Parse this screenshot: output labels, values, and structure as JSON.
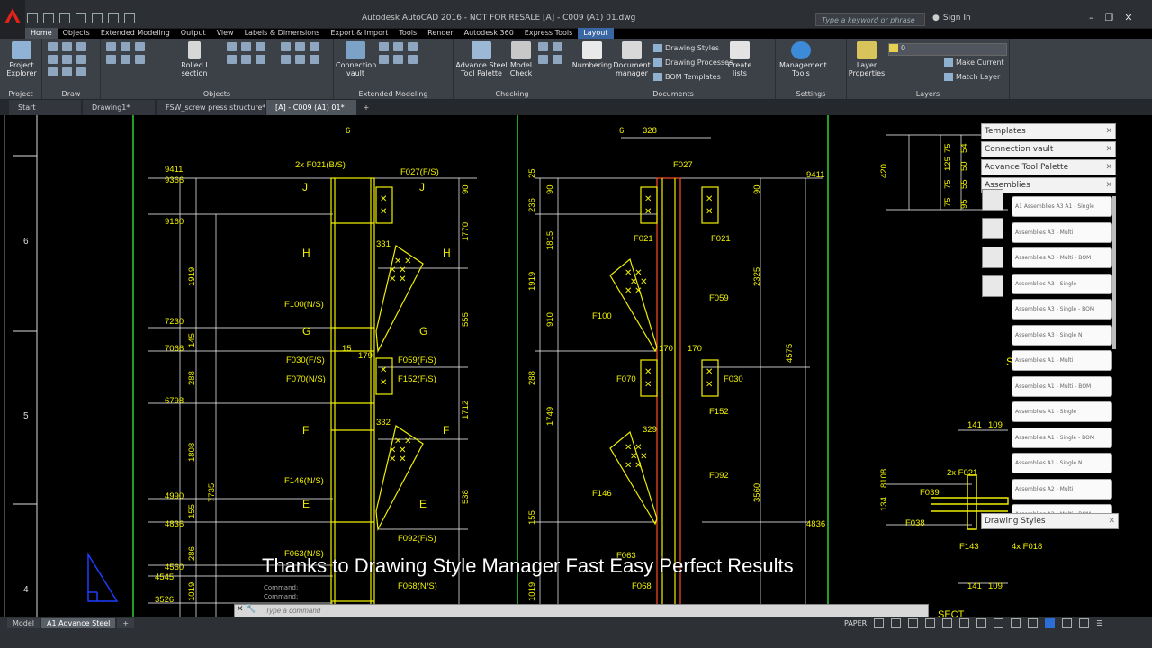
{
  "window": {
    "title": "Autodesk AutoCAD 2016 - NOT FOR RESALE    [A] - C009 (A1) 01.dwg",
    "search_placeholder": "Type a keyword or phrase",
    "signin": "Sign In"
  },
  "ribbon_tabs": [
    "Home",
    "Objects",
    "Extended Modeling",
    "Output",
    "View",
    "Labels & Dimensions",
    "Export & Import",
    "Tools",
    "Render",
    "Autodesk 360",
    "Express Tools",
    "Layout"
  ],
  "ribbon": {
    "project_explorer": "Project Explorer",
    "rolled_section": "Rolled I section",
    "connection_vault": "Connection vault",
    "advance_steel_tool_palette": "Advance Steel Tool Palette",
    "model_check": "Model Check",
    "numbering": "Numbering",
    "document_manager": "Document manager",
    "drawing_styles": "Drawing Styles",
    "drawing_processes": "Drawing Processes",
    "bom_templates": "BOM Templates",
    "create_lists": "Create lists",
    "management_tools": "Management Tools",
    "layer_properties": "Layer Properties",
    "layer_value": "0",
    "make_current": "Make Current",
    "match_layer": "Match Layer",
    "panels": {
      "project": "Project",
      "draw": "Draw",
      "objects": "Objects",
      "extended_modeling": "Extended Modeling",
      "checking": "Checking",
      "documents": "Documents",
      "settings": "Settings",
      "layers": "Layers"
    }
  },
  "doc_tabs": [
    "Start",
    "Drawing1*",
    "FSW_screw press structure*",
    "[A] - C009 (A1) 01*"
  ],
  "palette": {
    "headers": [
      "Templates",
      "Connection vault",
      "Advance Tool Palette",
      "Assemblies"
    ],
    "items": [
      "A1 Assemblies A3 A1 - Single",
      "Assemblies A3 - Multi",
      "Assemblies A3 - Multi - BOM",
      "Assemblies A3 - Single",
      "Assemblies A3 - Single - BOM",
      "Assemblies A3 - Single N",
      "Assemblies A1 - Multi",
      "Assemblies A1 - Multi - BOM",
      "Assemblies A1 - Single",
      "Assemblies A1 - Single - BOM",
      "Assemblies A1 - Single N",
      "Assemblies A2 - Multi",
      "Assemblies A2 - Multi - BOM"
    ],
    "footer": "Drawing Styles"
  },
  "drawing": {
    "ruler": [
      "6",
      "5",
      "4"
    ],
    "levels_left": [
      "9411",
      "9366",
      "9160",
      "7230",
      "7066",
      "6798",
      "4990",
      "4836",
      "4560",
      "4545",
      "3526"
    ],
    "dims_left": [
      "1919",
      "145",
      "288",
      "1808",
      "155",
      "286",
      "1019",
      "7735"
    ],
    "labels_left": [
      "2x F021(B/S)",
      "F027(F/S)",
      "F100(N/S)",
      "F030(F/S)",
      "F070(N/S)",
      "F059(F/S)",
      "F152(F/S)",
      "F146(N/S)",
      "F092(F/S)",
      "F063(N/S)",
      "F068(N/S)",
      "331",
      "332",
      "15",
      "179",
      "6"
    ],
    "section_marks": [
      "J",
      "J",
      "H",
      "H",
      "G",
      "G",
      "F",
      "F",
      "E",
      "E"
    ],
    "dims_right_left": [
      "1770",
      "555",
      "1712",
      "538",
      "90"
    ],
    "center_dims": [
      "236",
      "1815",
      "1919",
      "910",
      "288",
      "1749",
      "155",
      "1019",
      "25",
      "90"
    ],
    "labels_center": [
      "328",
      "F027",
      "F021",
      "F021",
      "F059",
      "F100",
      "F070",
      "F030",
      "F152",
      "F146",
      "F092",
      "F063",
      "F068",
      "170",
      "170",
      "329",
      "6"
    ],
    "dims_center_right": [
      "2325",
      "4575",
      "3560",
      "90"
    ],
    "levels_right": [
      "9411",
      "4836"
    ],
    "right_dims": [
      "420",
      "75",
      "125",
      "75",
      "50",
      "95",
      "75",
      "54",
      "55"
    ],
    "right_detail": [
      "141",
      "109",
      "2x F021",
      "F039",
      "F038",
      "F143",
      "4x F018",
      "134",
      "8108",
      "141",
      "109",
      "SECT",
      "S"
    ]
  },
  "caption": "Thanks to Drawing Style Manager  Fast Easy Perfect Results",
  "command": {
    "history": [
      "Command:",
      "Command:"
    ],
    "placeholder": "Type a command"
  },
  "layout_tabs": [
    "Model",
    "A1 Advance Steel"
  ],
  "status": {
    "paper": "PAPER"
  }
}
